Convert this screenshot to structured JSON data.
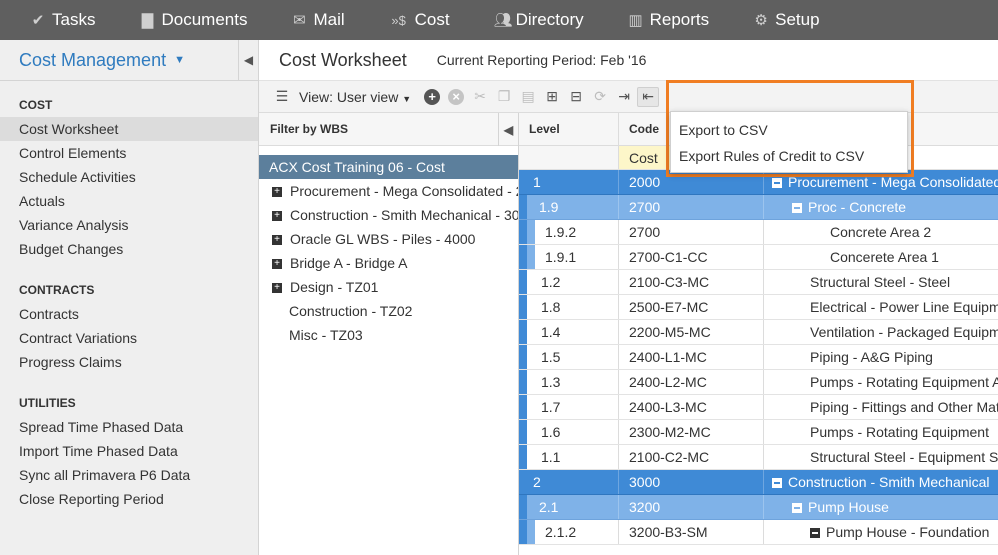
{
  "nav": {
    "items": [
      {
        "label": "Tasks",
        "icon": "check-icon"
      },
      {
        "label": "Documents",
        "icon": "document-icon"
      },
      {
        "label": "Mail",
        "icon": "envelope-icon"
      },
      {
        "label": "Cost",
        "icon": "dollar-icon"
      },
      {
        "label": "Directory",
        "icon": "people-icon"
      },
      {
        "label": "Reports",
        "icon": "bar-chart-icon"
      },
      {
        "label": "Setup",
        "icon": "gear-icon"
      }
    ]
  },
  "sidebar": {
    "title": "Cost Management",
    "sections": [
      {
        "heading": "COST",
        "items": [
          "Cost Worksheet",
          "Control Elements",
          "Schedule Activities",
          "Actuals",
          "Variance Analysis",
          "Budget Changes"
        ]
      },
      {
        "heading": "CONTRACTS",
        "items": [
          "Contracts",
          "Contract Variations",
          "Progress Claims"
        ]
      },
      {
        "heading": "UTILITIES",
        "items": [
          "Spread Time Phased Data",
          "Import Time Phased Data",
          "Sync all Primavera P6 Data",
          "Close Reporting Period"
        ]
      }
    ],
    "active_item": "Cost Worksheet"
  },
  "header": {
    "title": "Cost Worksheet",
    "period": "Current Reporting Period: Feb '16"
  },
  "toolbar": {
    "view_label": "View: User view"
  },
  "wbs": {
    "heading": "Filter by WBS",
    "selected": "ACX Cost Training 06 - Cost",
    "items": [
      {
        "label": "Procurement - Mega Consolidated - 2",
        "expandable": true
      },
      {
        "label": "Construction - Smith Mechanical - 30",
        "expandable": true
      },
      {
        "label": "Oracle GL WBS - Piles - 4000",
        "expandable": true
      },
      {
        "label": "Bridge A - Bridge A",
        "expandable": true
      },
      {
        "label": "Design - TZ01",
        "expandable": true
      },
      {
        "label": "Construction - TZ02",
        "expandable": false
      },
      {
        "label": "Misc - TZ03",
        "expandable": false
      }
    ]
  },
  "grid": {
    "columns": [
      "Level",
      "Code"
    ],
    "sub_header": "Cost",
    "rows": [
      {
        "level": "1",
        "code": "2000",
        "desc": "Procurement - Mega Consolidated",
        "tier": "l0"
      },
      {
        "level": "1.9",
        "code": "2700",
        "desc": "Proc - Concrete",
        "tier": "l1"
      },
      {
        "level": "1.9.2",
        "code": "2700",
        "desc": "Concrete Area 2",
        "tier": "l2"
      },
      {
        "level": "1.9.1",
        "code": "2700-C1-CC",
        "desc": "Concerete Area 1",
        "tier": "l2"
      },
      {
        "level": "1.2",
        "code": "2100-C3-MC",
        "desc": "Structural Steel - Steel",
        "tier": "leaf"
      },
      {
        "level": "1.8",
        "code": "2500-E7-MC",
        "desc": "Electrical - Power Line Equipm",
        "tier": "leaf"
      },
      {
        "level": "1.4",
        "code": "2200-M5-MC",
        "desc": "Ventilation - Packaged Equipm",
        "tier": "leaf"
      },
      {
        "level": "1.5",
        "code": "2400-L1-MC",
        "desc": "Piping - A&G Piping",
        "tier": "leaf"
      },
      {
        "level": "1.3",
        "code": "2400-L2-MC",
        "desc": "Pumps - Rotating Equipment A",
        "tier": "leaf"
      },
      {
        "level": "1.7",
        "code": "2400-L3-MC",
        "desc": "Piping - Fittings and Other Mat",
        "tier": "leaf"
      },
      {
        "level": "1.6",
        "code": "2300-M2-MC",
        "desc": "Pumps - Rotating Equipment",
        "tier": "leaf"
      },
      {
        "level": "1.1",
        "code": "2100-C2-MC",
        "desc": "Structural Steel - Equipment S",
        "tier": "leaf"
      },
      {
        "level": "2",
        "code": "3000",
        "desc": "Construction - Smith Mechanical",
        "tier": "l0"
      },
      {
        "level": "2.1",
        "code": "3200",
        "desc": "Pump House",
        "tier": "l1"
      },
      {
        "level": "2.1.2",
        "code": "3200-B3-SM",
        "desc": "Pump House - Foundation",
        "tier": "l2x"
      }
    ]
  },
  "export_menu": {
    "items": [
      "Export to CSV",
      "Export Rules of Credit to CSV"
    ],
    "highlight_color": "#f07d22"
  }
}
